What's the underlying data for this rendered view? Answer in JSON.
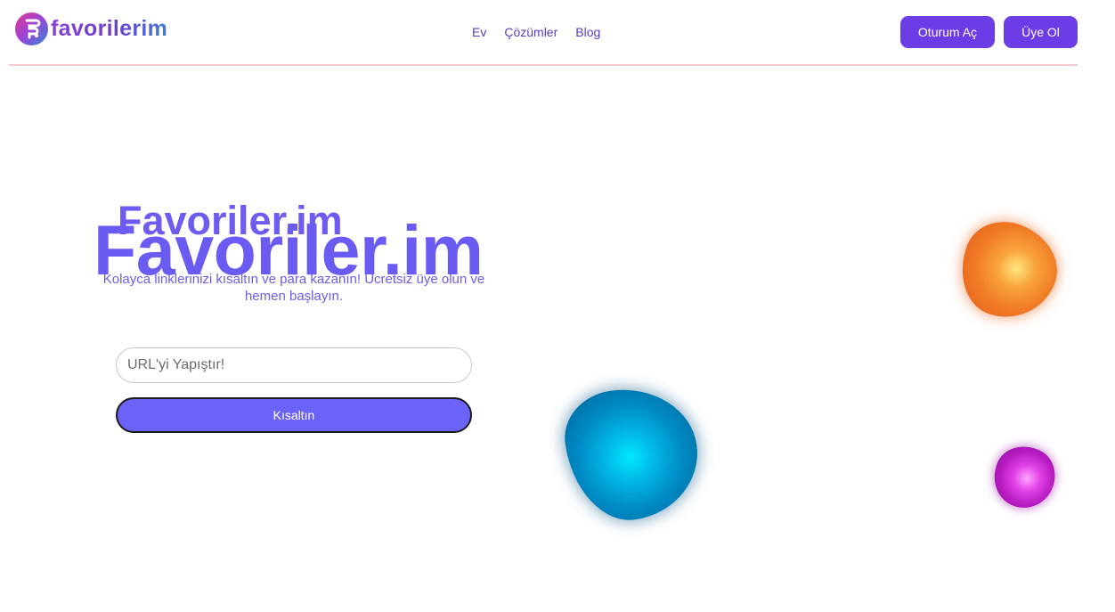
{
  "brand": {
    "name": "favorilerim"
  },
  "nav": [
    {
      "label": "Ev"
    },
    {
      "label": "Çözümler"
    },
    {
      "label": "Blog"
    }
  ],
  "auth": {
    "login_label": "Oturum Aç",
    "signup_label": "Üye Ol"
  },
  "hero": {
    "title_small": "Favoriler.im",
    "title_big": "Favoriler.im",
    "subtitle": "Kolayca linklerinizi kısaltın ve para kazanın! Ücretsiz üye olun ve hemen başlayın."
  },
  "form": {
    "url_placeholder": "URL'yi Yapıştır!",
    "url_value": "",
    "submit_label": "Kısaltın"
  },
  "colors": {
    "accent": "#6c3ce6",
    "hero_text": "#6a5cf2",
    "nav_text": "#5b3cc4",
    "divider": "#f4c9cf"
  }
}
